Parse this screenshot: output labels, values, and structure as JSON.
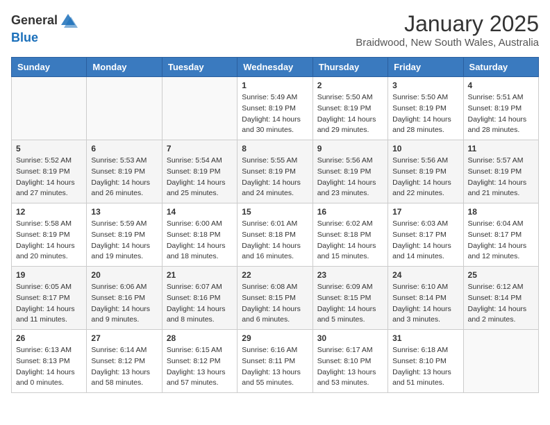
{
  "header": {
    "logo_line1": "General",
    "logo_line2": "Blue",
    "month": "January 2025",
    "location": "Braidwood, New South Wales, Australia"
  },
  "days_of_week": [
    "Sunday",
    "Monday",
    "Tuesday",
    "Wednesday",
    "Thursday",
    "Friday",
    "Saturday"
  ],
  "weeks": [
    [
      {
        "day": "",
        "info": []
      },
      {
        "day": "",
        "info": []
      },
      {
        "day": "",
        "info": []
      },
      {
        "day": "1",
        "info": [
          "Sunrise: 5:49 AM",
          "Sunset: 8:19 PM",
          "Daylight: 14 hours",
          "and 30 minutes."
        ]
      },
      {
        "day": "2",
        "info": [
          "Sunrise: 5:50 AM",
          "Sunset: 8:19 PM",
          "Daylight: 14 hours",
          "and 29 minutes."
        ]
      },
      {
        "day": "3",
        "info": [
          "Sunrise: 5:50 AM",
          "Sunset: 8:19 PM",
          "Daylight: 14 hours",
          "and 28 minutes."
        ]
      },
      {
        "day": "4",
        "info": [
          "Sunrise: 5:51 AM",
          "Sunset: 8:19 PM",
          "Daylight: 14 hours",
          "and 28 minutes."
        ]
      }
    ],
    [
      {
        "day": "5",
        "info": [
          "Sunrise: 5:52 AM",
          "Sunset: 8:19 PM",
          "Daylight: 14 hours",
          "and 27 minutes."
        ]
      },
      {
        "day": "6",
        "info": [
          "Sunrise: 5:53 AM",
          "Sunset: 8:19 PM",
          "Daylight: 14 hours",
          "and 26 minutes."
        ]
      },
      {
        "day": "7",
        "info": [
          "Sunrise: 5:54 AM",
          "Sunset: 8:19 PM",
          "Daylight: 14 hours",
          "and 25 minutes."
        ]
      },
      {
        "day": "8",
        "info": [
          "Sunrise: 5:55 AM",
          "Sunset: 8:19 PM",
          "Daylight: 14 hours",
          "and 24 minutes."
        ]
      },
      {
        "day": "9",
        "info": [
          "Sunrise: 5:56 AM",
          "Sunset: 8:19 PM",
          "Daylight: 14 hours",
          "and 23 minutes."
        ]
      },
      {
        "day": "10",
        "info": [
          "Sunrise: 5:56 AM",
          "Sunset: 8:19 PM",
          "Daylight: 14 hours",
          "and 22 minutes."
        ]
      },
      {
        "day": "11",
        "info": [
          "Sunrise: 5:57 AM",
          "Sunset: 8:19 PM",
          "Daylight: 14 hours",
          "and 21 minutes."
        ]
      }
    ],
    [
      {
        "day": "12",
        "info": [
          "Sunrise: 5:58 AM",
          "Sunset: 8:19 PM",
          "Daylight: 14 hours",
          "and 20 minutes."
        ]
      },
      {
        "day": "13",
        "info": [
          "Sunrise: 5:59 AM",
          "Sunset: 8:19 PM",
          "Daylight: 14 hours",
          "and 19 minutes."
        ]
      },
      {
        "day": "14",
        "info": [
          "Sunrise: 6:00 AM",
          "Sunset: 8:18 PM",
          "Daylight: 14 hours",
          "and 18 minutes."
        ]
      },
      {
        "day": "15",
        "info": [
          "Sunrise: 6:01 AM",
          "Sunset: 8:18 PM",
          "Daylight: 14 hours",
          "and 16 minutes."
        ]
      },
      {
        "day": "16",
        "info": [
          "Sunrise: 6:02 AM",
          "Sunset: 8:18 PM",
          "Daylight: 14 hours",
          "and 15 minutes."
        ]
      },
      {
        "day": "17",
        "info": [
          "Sunrise: 6:03 AM",
          "Sunset: 8:17 PM",
          "Daylight: 14 hours",
          "and 14 minutes."
        ]
      },
      {
        "day": "18",
        "info": [
          "Sunrise: 6:04 AM",
          "Sunset: 8:17 PM",
          "Daylight: 14 hours",
          "and 12 minutes."
        ]
      }
    ],
    [
      {
        "day": "19",
        "info": [
          "Sunrise: 6:05 AM",
          "Sunset: 8:17 PM",
          "Daylight: 14 hours",
          "and 11 minutes."
        ]
      },
      {
        "day": "20",
        "info": [
          "Sunrise: 6:06 AM",
          "Sunset: 8:16 PM",
          "Daylight: 14 hours",
          "and 9 minutes."
        ]
      },
      {
        "day": "21",
        "info": [
          "Sunrise: 6:07 AM",
          "Sunset: 8:16 PM",
          "Daylight: 14 hours",
          "and 8 minutes."
        ]
      },
      {
        "day": "22",
        "info": [
          "Sunrise: 6:08 AM",
          "Sunset: 8:15 PM",
          "Daylight: 14 hours",
          "and 6 minutes."
        ]
      },
      {
        "day": "23",
        "info": [
          "Sunrise: 6:09 AM",
          "Sunset: 8:15 PM",
          "Daylight: 14 hours",
          "and 5 minutes."
        ]
      },
      {
        "day": "24",
        "info": [
          "Sunrise: 6:10 AM",
          "Sunset: 8:14 PM",
          "Daylight: 14 hours",
          "and 3 minutes."
        ]
      },
      {
        "day": "25",
        "info": [
          "Sunrise: 6:12 AM",
          "Sunset: 8:14 PM",
          "Daylight: 14 hours",
          "and 2 minutes."
        ]
      }
    ],
    [
      {
        "day": "26",
        "info": [
          "Sunrise: 6:13 AM",
          "Sunset: 8:13 PM",
          "Daylight: 14 hours",
          "and 0 minutes."
        ]
      },
      {
        "day": "27",
        "info": [
          "Sunrise: 6:14 AM",
          "Sunset: 8:12 PM",
          "Daylight: 13 hours",
          "and 58 minutes."
        ]
      },
      {
        "day": "28",
        "info": [
          "Sunrise: 6:15 AM",
          "Sunset: 8:12 PM",
          "Daylight: 13 hours",
          "and 57 minutes."
        ]
      },
      {
        "day": "29",
        "info": [
          "Sunrise: 6:16 AM",
          "Sunset: 8:11 PM",
          "Daylight: 13 hours",
          "and 55 minutes."
        ]
      },
      {
        "day": "30",
        "info": [
          "Sunrise: 6:17 AM",
          "Sunset: 8:10 PM",
          "Daylight: 13 hours",
          "and 53 minutes."
        ]
      },
      {
        "day": "31",
        "info": [
          "Sunrise: 6:18 AM",
          "Sunset: 8:10 PM",
          "Daylight: 13 hours",
          "and 51 minutes."
        ]
      },
      {
        "day": "",
        "info": []
      }
    ]
  ]
}
